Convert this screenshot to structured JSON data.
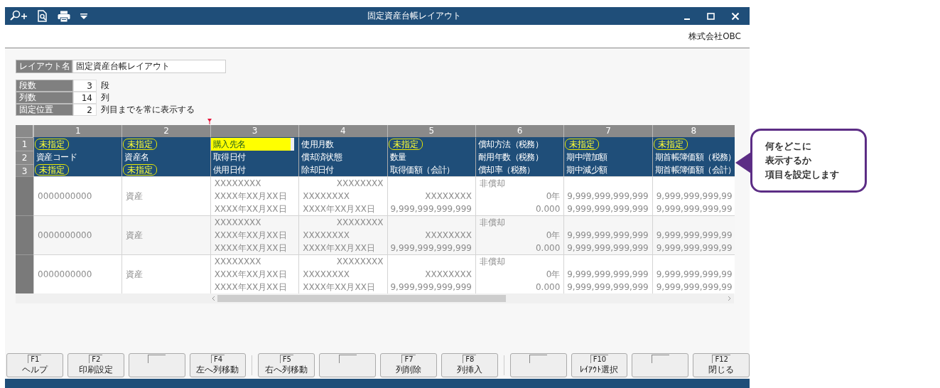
{
  "window": {
    "title": "固定資産台帳レイアウト",
    "company": "株式会社OBC"
  },
  "layout_name": {
    "label": "レイアウト名",
    "value": "固定資産台帳レイアウト"
  },
  "settings": [
    {
      "label": "段数",
      "value": "3",
      "unit": "段"
    },
    {
      "label": "列数",
      "value": "14",
      "unit": "列"
    },
    {
      "label": "固定位置",
      "value": "2",
      "unit": "列目までを常に表示する"
    }
  ],
  "table": {
    "row_numbers": [
      "1",
      "2",
      "3"
    ],
    "columns": [
      {
        "number": "1",
        "slots": [
          {
            "kind": "badge",
            "text": "未指定",
            "selected": false
          },
          {
            "kind": "field",
            "text": "資産コード",
            "selected": false
          },
          {
            "kind": "badge",
            "text": "未指定",
            "selected": false
          }
        ]
      },
      {
        "number": "2",
        "slots": [
          {
            "kind": "badge",
            "text": "未指定",
            "selected": false
          },
          {
            "kind": "field",
            "text": "資産名",
            "selected": false
          },
          {
            "kind": "badge",
            "text": "未指定",
            "selected": false
          }
        ]
      },
      {
        "number": "3",
        "slots": [
          {
            "kind": "field",
            "text": "購入先名",
            "selected": true
          },
          {
            "kind": "field",
            "text": "取得日付",
            "selected": false
          },
          {
            "kind": "field",
            "text": "供用日付",
            "selected": false
          }
        ]
      },
      {
        "number": "4",
        "slots": [
          {
            "kind": "field",
            "text": "使用月数",
            "selected": false
          },
          {
            "kind": "field",
            "text": "償却済状態",
            "selected": false
          },
          {
            "kind": "field",
            "text": "除却日付",
            "selected": false
          }
        ]
      },
      {
        "number": "5",
        "slots": [
          {
            "kind": "badge",
            "text": "未指定",
            "selected": false
          },
          {
            "kind": "field",
            "text": "数量",
            "selected": false
          },
          {
            "kind": "field",
            "text": "取得価額（会計）",
            "selected": false
          }
        ]
      },
      {
        "number": "6",
        "slots": [
          {
            "kind": "field",
            "text": "償却方法（税務）",
            "selected": false
          },
          {
            "kind": "field",
            "text": "耐用年数（税務）",
            "selected": false
          },
          {
            "kind": "field",
            "text": "償却率（税務）",
            "selected": false
          }
        ]
      },
      {
        "number": "7",
        "slots": [
          {
            "kind": "badge",
            "text": "未指定",
            "selected": false
          },
          {
            "kind": "field",
            "text": "期中増加額",
            "selected": false
          },
          {
            "kind": "field",
            "text": "期中減少額",
            "selected": false
          }
        ]
      },
      {
        "number": "8",
        "slots": [
          {
            "kind": "badge",
            "text": "未指定",
            "selected": false
          },
          {
            "kind": "field",
            "text": "期首帳簿価額（税務）",
            "selected": false
          },
          {
            "kind": "field",
            "text": "期首帳簿価額（会計）",
            "selected": false
          }
        ]
      }
    ],
    "rows": [
      {
        "cells": [
          {
            "kind": "single",
            "text": "0000000000"
          },
          {
            "kind": "single",
            "text": "資産"
          },
          {
            "kind": "stacked",
            "lines": [
              {
                "kind": "left",
                "text": "XXXXXXXX"
              },
              {
                "kind": "left",
                "text": "XXXX年XX月XX日"
              },
              {
                "kind": "left",
                "text": "XXXX年XX月XX日"
              }
            ]
          },
          {
            "kind": "stacked",
            "lines": [
              {
                "kind": "right",
                "text": "XXXXXXXX"
              },
              {
                "kind": "left",
                "text": "XXXXXXXX"
              },
              {
                "kind": "left",
                "text": "XXXX年XX月XX日"
              }
            ]
          },
          {
            "kind": "stacked",
            "lines": [
              {
                "kind": "blank"
              },
              {
                "kind": "right",
                "text": "XXXXXXXX"
              },
              {
                "kind": "right",
                "text": "9,999,999,999,999"
              }
            ]
          },
          {
            "kind": "stacked",
            "lines": [
              {
                "kind": "left",
                "text": "非償却"
              },
              {
                "kind": "right",
                "text": "0年"
              },
              {
                "kind": "right",
                "text": "0.000"
              }
            ]
          },
          {
            "kind": "stacked",
            "lines": [
              {
                "kind": "blank"
              },
              {
                "kind": "right",
                "text": "9,999,999,999,999"
              },
              {
                "kind": "right",
                "text": "9,999,999,999,999"
              }
            ]
          },
          {
            "kind": "stacked",
            "lines": [
              {
                "kind": "blank"
              },
              {
                "kind": "left",
                "text": "9,999,999,999,99"
              },
              {
                "kind": "left",
                "text": "9,999,999,999,99"
              }
            ]
          }
        ]
      },
      {
        "cells": [
          {
            "kind": "single",
            "text": "0000000000"
          },
          {
            "kind": "single",
            "text": "資産"
          },
          {
            "kind": "stacked",
            "lines": [
              {
                "kind": "left",
                "text": "XXXXXXXX"
              },
              {
                "kind": "left",
                "text": "XXXX年XX月XX日"
              },
              {
                "kind": "left",
                "text": "XXXX年XX月XX日"
              }
            ]
          },
          {
            "kind": "stacked",
            "lines": [
              {
                "kind": "right",
                "text": "XXXXXXXX"
              },
              {
                "kind": "left",
                "text": "XXXXXXXX"
              },
              {
                "kind": "left",
                "text": "XXXX年XX月XX日"
              }
            ]
          },
          {
            "kind": "stacked",
            "lines": [
              {
                "kind": "blank"
              },
              {
                "kind": "right",
                "text": "XXXXXXXX"
              },
              {
                "kind": "right",
                "text": "9,999,999,999,999"
              }
            ]
          },
          {
            "kind": "stacked",
            "lines": [
              {
                "kind": "left",
                "text": "非償却"
              },
              {
                "kind": "right",
                "text": "0年"
              },
              {
                "kind": "right",
                "text": "0.000"
              }
            ]
          },
          {
            "kind": "stacked",
            "lines": [
              {
                "kind": "blank"
              },
              {
                "kind": "right",
                "text": "9,999,999,999,999"
              },
              {
                "kind": "right",
                "text": "9,999,999,999,999"
              }
            ]
          },
          {
            "kind": "stacked",
            "lines": [
              {
                "kind": "blank"
              },
              {
                "kind": "left",
                "text": "9,999,999,999,99"
              },
              {
                "kind": "left",
                "text": "9,999,999,999,99"
              }
            ]
          }
        ]
      },
      {
        "cells": [
          {
            "kind": "single",
            "text": "0000000000"
          },
          {
            "kind": "single",
            "text": "資産"
          },
          {
            "kind": "stacked",
            "lines": [
              {
                "kind": "left",
                "text": "XXXXXXXX"
              },
              {
                "kind": "left",
                "text": "XXXX年XX月XX日"
              },
              {
                "kind": "left",
                "text": "XXXX年XX月XX日"
              }
            ]
          },
          {
            "kind": "stacked",
            "lines": [
              {
                "kind": "right",
                "text": "XXXXXXXX"
              },
              {
                "kind": "left",
                "text": "XXXXXXXX"
              },
              {
                "kind": "left",
                "text": "XXXX年XX月XX日"
              }
            ]
          },
          {
            "kind": "stacked",
            "lines": [
              {
                "kind": "blank"
              },
              {
                "kind": "right",
                "text": "XXXXXXXX"
              },
              {
                "kind": "right",
                "text": "9,999,999,999,999"
              }
            ]
          },
          {
            "kind": "stacked",
            "lines": [
              {
                "kind": "left",
                "text": "非償却"
              },
              {
                "kind": "right",
                "text": "0年"
              },
              {
                "kind": "right",
                "text": "0.000"
              }
            ]
          },
          {
            "kind": "stacked",
            "lines": [
              {
                "kind": "blank"
              },
              {
                "kind": "right",
                "text": "9,999,999,999,999"
              },
              {
                "kind": "right",
                "text": "9,999,999,999,999"
              }
            ]
          },
          {
            "kind": "stacked",
            "lines": [
              {
                "kind": "blank"
              },
              {
                "kind": "left",
                "text": "9,999,999,999,99"
              },
              {
                "kind": "left",
                "text": "9,999,999,999,99"
              }
            ]
          }
        ]
      }
    ]
  },
  "callout": {
    "lines": [
      "何をどこに",
      "表示するか",
      "項目を設定します"
    ]
  },
  "function_keys": [
    [
      {
        "key": "F1",
        "label": "ヘルプ"
      },
      {
        "key": "F2",
        "label": "印刷設定"
      },
      {
        "kind": "blank"
      },
      {
        "key": "F4",
        "label": "左へ列移動"
      }
    ],
    [
      {
        "key": "F5",
        "label": "右へ列移動"
      },
      {
        "kind": "blank"
      },
      {
        "key": "F7",
        "label": "列削除"
      },
      {
        "key": "F8",
        "label": "列挿入"
      }
    ],
    [
      {
        "kind": "blank"
      },
      {
        "key": "F10",
        "label": "ﾚｲｱｳﾄ選択"
      },
      {
        "kind": "blank"
      },
      {
        "key": "F12",
        "label": "閉じる"
      }
    ]
  ]
}
